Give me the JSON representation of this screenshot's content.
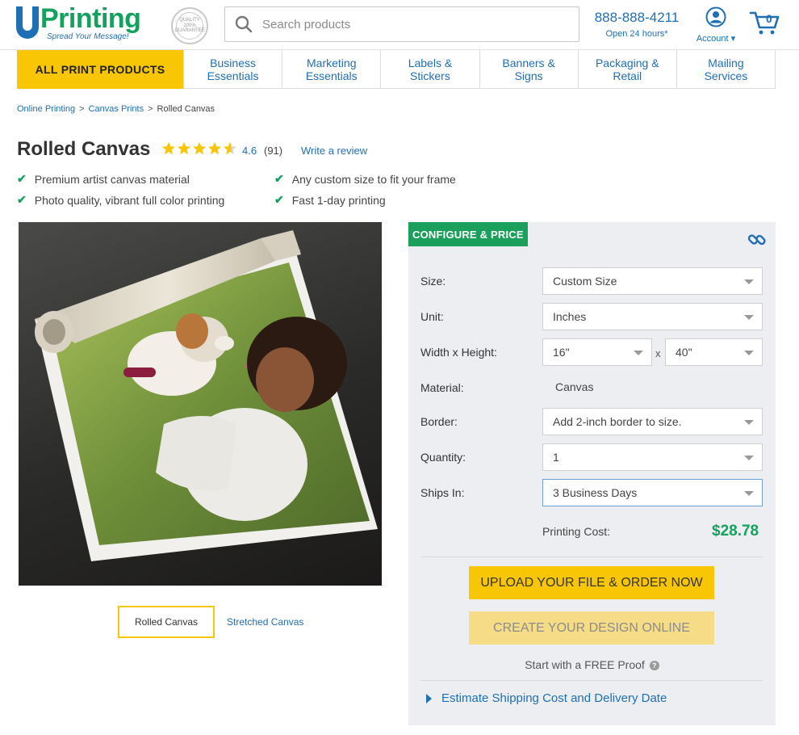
{
  "header": {
    "logo_text": "Printing",
    "logo_tagline": "Spread Your Message!",
    "seal_text": "QUALITY 100% GUARANTEE",
    "search_placeholder": "Search products",
    "phone_number": "888-888-4211",
    "phone_sub": "Open 24 hours*",
    "account_label": "Account ▾",
    "cart_count": "0",
    "colors": {
      "brand_blue": "#1f6fb5",
      "brand_green": "#16a05d",
      "accent_yellow": "#f9c606"
    }
  },
  "nav": {
    "all_label": "ALL PRINT PRODUCTS",
    "items": [
      {
        "line1": "Business",
        "line2": "Essentials"
      },
      {
        "line1": "Marketing",
        "line2": "Essentials"
      },
      {
        "line1": "Labels &",
        "line2": "Stickers"
      },
      {
        "line1": "Banners &",
        "line2": "Signs"
      },
      {
        "line1": "Packaging &",
        "line2": "Retail"
      },
      {
        "line1": "Mailing",
        "line2": "Services"
      }
    ]
  },
  "breadcrumb": {
    "items": [
      "Online Printing",
      "Canvas Prints"
    ],
    "current": "Rolled Canvas",
    "separator": ">"
  },
  "product": {
    "title": "Rolled Canvas",
    "rating": "4.6",
    "rating_value": 4.6,
    "review_count": "(91)",
    "write_review": "Write a review",
    "features": [
      "Premium artist canvas material",
      "Any custom size to fit your frame",
      "Photo quality, vibrant full color printing",
      "Fast 1-day printing"
    ],
    "image_icon": "rolled-canvas-photo",
    "tabs": {
      "active": "Rolled Canvas",
      "other": "Stretched Canvas"
    }
  },
  "config": {
    "title": "CONFIGURE & PRICE",
    "link_icon": "link-icon",
    "labels": {
      "size": "Size:",
      "unit": "Unit:",
      "wh": "Width x Height:",
      "material": "Material:",
      "border": "Border:",
      "quantity": "Quantity:",
      "ships": "Ships In:"
    },
    "values": {
      "size": "Custom Size",
      "unit": "Inches",
      "width": "16\"",
      "height": "40\"",
      "material": "Canvas",
      "border": "Add 2-inch border to size.",
      "quantity": "1",
      "ships": "3 Business Days"
    },
    "x_separator": "x",
    "cost_label": "Printing Cost:",
    "cost": "$28.78",
    "upload_button": "UPLOAD YOUR FILE & ORDER NOW",
    "design_button": "CREATE YOUR DESIGN ONLINE",
    "proof_text": "Start with a FREE Proof",
    "estimate_link": "Estimate Shipping Cost and Delivery Date"
  }
}
